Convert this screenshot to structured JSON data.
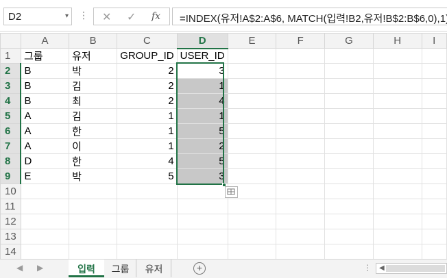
{
  "formula_bar": {
    "cell_ref": "D2",
    "name_box_arrow": "▾",
    "more_dots": "⋮",
    "cancel_glyph": "✕",
    "enter_glyph": "✓",
    "function_glyph": "fx",
    "formula": "=INDEX(유저!A$2:A$6, MATCH(입력!B2,유저!B$2:B$6,0),1)"
  },
  "sheet": {
    "columns": [
      "A",
      "B",
      "C",
      "D",
      "E",
      "F",
      "G",
      "H",
      "I"
    ],
    "selected_column": "D",
    "row_numbers": [
      "1",
      "2",
      "3",
      "4",
      "5",
      "6",
      "7",
      "8",
      "9",
      "10",
      "11",
      "12",
      "13",
      "14"
    ],
    "headers": {
      "a": "그룹",
      "b": "유저",
      "c": "GROUP_ID",
      "d": "USER_ID"
    },
    "rows": [
      {
        "a": "B",
        "b": "박",
        "c": "2",
        "d": "3"
      },
      {
        "a": "B",
        "b": "김",
        "c": "2",
        "d": "1"
      },
      {
        "a": "B",
        "b": "최",
        "c": "2",
        "d": "4"
      },
      {
        "a": "A",
        "b": "김",
        "c": "1",
        "d": "1"
      },
      {
        "a": "A",
        "b": "한",
        "c": "1",
        "d": "5"
      },
      {
        "a": "A",
        "b": "이",
        "c": "1",
        "d": "2"
      },
      {
        "a": "D",
        "b": "한",
        "c": "4",
        "d": "5"
      },
      {
        "a": "E",
        "b": "박",
        "c": "5",
        "d": "3"
      }
    ]
  },
  "tabs": {
    "prev_glyph": "◀",
    "next_glyph": "▶",
    "names": [
      "입력",
      "그룹",
      "유저"
    ],
    "active": "입력",
    "add_glyph": "+",
    "dots": "⋮",
    "scroll_left_glyph": "◀"
  },
  "colors": {
    "accent": "#217346",
    "selection_fill": "#c8c8c8"
  }
}
